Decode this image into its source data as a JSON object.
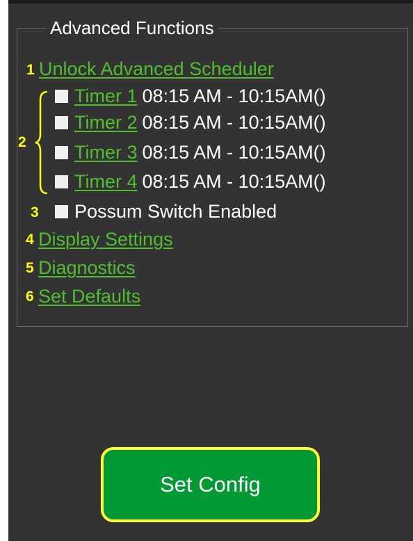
{
  "section": {
    "title": "Advanced Functions"
  },
  "markers": [
    "1",
    "2",
    "3",
    "4",
    "5",
    "6"
  ],
  "links": {
    "unlock_scheduler": "Unlock Advanced Scheduler",
    "display_settings": "Display Settings",
    "diagnostics": "Diagnostics",
    "set_defaults": "Set Defaults"
  },
  "timers": [
    {
      "label": "Timer 1",
      "range": "08:15 AM - 10:15AM()",
      "checked": false
    },
    {
      "label": "Timer 2",
      "range": "08:15 AM - 10:15AM()",
      "checked": false
    },
    {
      "label": "Timer 3",
      "range": "08:15 AM - 10:15AM()",
      "checked": false
    },
    {
      "label": "Timer 4",
      "range": "08:15 AM - 10:15AM()",
      "checked": false
    }
  ],
  "possum_switch": {
    "label": "Possum Switch Enabled",
    "checked": false
  },
  "actions": {
    "set_config": "Set Config"
  },
  "colors": {
    "panel_bg": "#333333",
    "link_green": "#4fbf2d",
    "annotation_yellow": "#ffff00",
    "button_green": "#009933",
    "button_border": "#ffff33"
  }
}
